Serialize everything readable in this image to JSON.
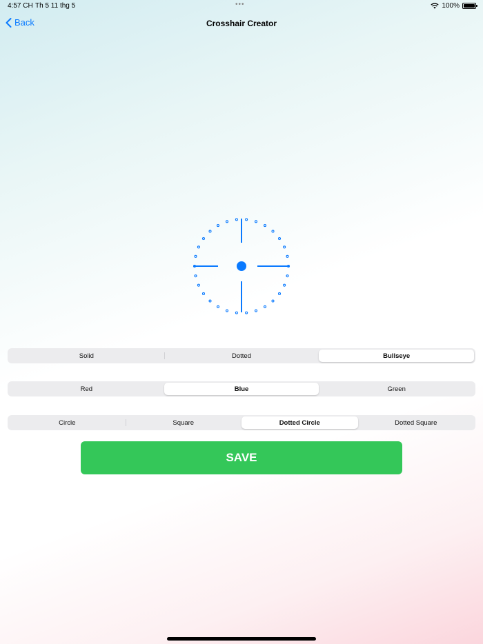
{
  "status_bar": {
    "time": "4:57 CH",
    "date": "Th 5 11 thg 5",
    "battery": "100%",
    "icons": [
      "wifi-icon",
      "battery-icon"
    ]
  },
  "nav": {
    "back_label": "Back",
    "title": "Crosshair Creator"
  },
  "preview": {
    "accent_color": "#0a7aff",
    "crosshair_style": "Bullseye",
    "frame": "Dotted Circle"
  },
  "style_control": {
    "options": [
      "Solid",
      "Dotted",
      "Bullseye"
    ],
    "selected": "Bullseye"
  },
  "color_control": {
    "options": [
      "Red",
      "Blue",
      "Green"
    ],
    "selected": "Blue"
  },
  "shape_control": {
    "options": [
      "Circle",
      "Square",
      "Dotted Circle",
      "Dotted Square"
    ],
    "selected": "Dotted Circle"
  },
  "save_label": "SAVE",
  "colors": {
    "save_button": "#34c759",
    "link": "#0a7aff"
  }
}
